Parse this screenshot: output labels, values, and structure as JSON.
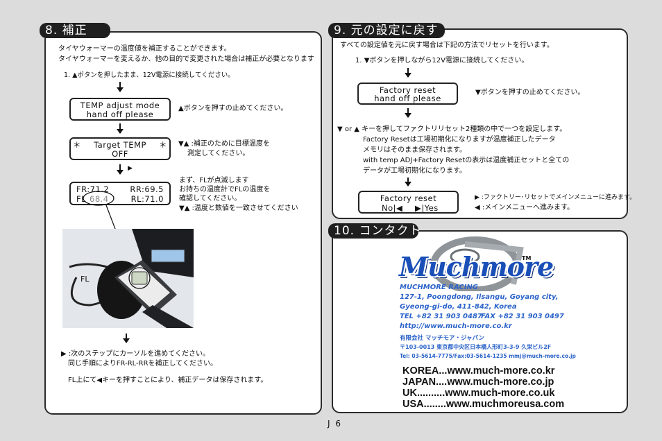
{
  "page_number": "J 6",
  "section8": {
    "title": "8. 補正",
    "intro": [
      "タイヤウォーマーの温度値を補正することができます。",
      "タイヤウォーマーを変えるか、他の目的で変更された場合は補正が必要となります"
    ],
    "step1": "1. ▲ボタンを押したまま、12V電源に接続してください。",
    "lcd1": {
      "line1": "TEMP adjust mode",
      "line2": "hand off please"
    },
    "lcd1_note": "▲ボタンを押すの止めてください。",
    "lcd2": {
      "left_mark": "＊",
      "line1": "Target TEMP",
      "right_mark": "＊",
      "line2": "OFF"
    },
    "lcd2_note": [
      "▼▲ :補正のために目標温度を",
      "測定してください。"
    ],
    "next_key": "▶",
    "lcd3": {
      "fr": "FR:71.2",
      "rr": "RR:69.5",
      "fl_label": "FL",
      "fl_value": "68.4",
      "rl": "RL:71.0"
    },
    "lcd3_note": [
      "まず、FLが点滅します",
      "お持ちの温度計でFLの温度を",
      "確認してください。",
      "▼▲ :温度と数値を一致させてください"
    ],
    "photo_label": "FL",
    "after_photo": [
      "▶ :次のステップにカーソルを進めてください。",
      "同じ手順によりFR-RL-RRを補正してください。"
    ],
    "save_note": "FL上にて◀キーを押すことにより、補正データは保存されます。"
  },
  "section9": {
    "title": "9. 元の設定に戻す",
    "intro": "すべての設定値を元に戻す場合は下記の方法でリセットを行います。",
    "step1": "1. ▼ボタンを押しながら12V電源に接続してください。",
    "lcd1": {
      "line1": "Factory reset",
      "line2": "hand off please"
    },
    "lcd1_note": "▼ボタンを押すの止めてください。",
    "choose": [
      "▼ or ▲ キーを押してファクトリリセット2種類の中で一つを設定します。",
      "Factory Resetは工場初期化になりますが温度補正したデータ",
      "メモリはそのまま保存されます。",
      "with temp ADJ+Factory Resetの表示は温度補正セットと全ての",
      "データが工場初期化になります。"
    ],
    "lcd2": {
      "line1": "Factory reset",
      "no": "No|◀",
      "yes": "▶|Yes"
    },
    "lcd2_note": [
      "▶ :ファクトリー･リセットでメインメニューに進みます。",
      "◀ :メインメニューへ進みます。"
    ]
  },
  "section10": {
    "title": "10. コンタクト",
    "logo": "Muchmore",
    "trademark": "TM",
    "company": "MUCHMORE RACING",
    "address": [
      "127-1, Poongdong, Ilsangu, Goyang city,",
      "Gyeong-gi-do, 411-842, Korea"
    ],
    "tel": "TEL +82 31 903 0487",
    "fax": "FAX +82 31 903 0497",
    "url": "http://www.much-more.co.kr",
    "japan_company": "有限会社 マッチモア・ジャパン",
    "japan_address": "〒103-0013 東京都中央区日本橋人形町3-3-9 久栄ビル2F",
    "japan_contact": "Tel: 03-5614-7775/Fax:03-5614-1235   mmj@much-more.co.jp",
    "sites": [
      "KOREA...www.much-more.co.kr",
      "JAPAN....www.much-more.co.jp",
      "UK..........www.much-more.co.uk",
      "USA........www.muchmoreusa.com"
    ]
  }
}
